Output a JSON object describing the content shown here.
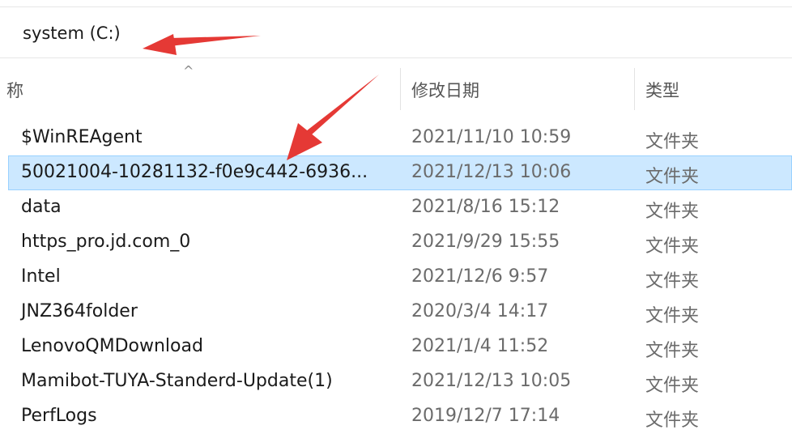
{
  "address_bar": {
    "path": "system (C:)"
  },
  "columns": {
    "name": "称",
    "date_modified": "修改日期",
    "type": "类型"
  },
  "rows": [
    {
      "name": "$WinREAgent",
      "date": "2021/11/10 10:59",
      "type": "文件夹"
    },
    {
      "name": "50021004-10281132-f0e9c442-6936...",
      "date": "2021/12/13 10:06",
      "type": "文件夹"
    },
    {
      "name": "data",
      "date": "2021/8/16 15:12",
      "type": "文件夹"
    },
    {
      "name": "https_pro.jd.com_0",
      "date": "2021/9/29 15:55",
      "type": "文件夹"
    },
    {
      "name": "Intel",
      "date": "2021/12/6 9:57",
      "type": "文件夹"
    },
    {
      "name": "JNZ364folder",
      "date": "2020/3/4 14:17",
      "type": "文件夹"
    },
    {
      "name": "LenovoQMDownload",
      "date": "2021/1/4 11:52",
      "type": "文件夹"
    },
    {
      "name": "Mamibot-TUYA-Standerd-Update(1)",
      "date": "2021/12/13 10:05",
      "type": "文件夹"
    },
    {
      "name": "PerfLogs",
      "date": "2019/12/7 17:14",
      "type": "文件夹"
    }
  ],
  "selected_row_index": 1,
  "colors": {
    "selection": "#cce8ff",
    "annotation_arrow": "#e53935"
  }
}
